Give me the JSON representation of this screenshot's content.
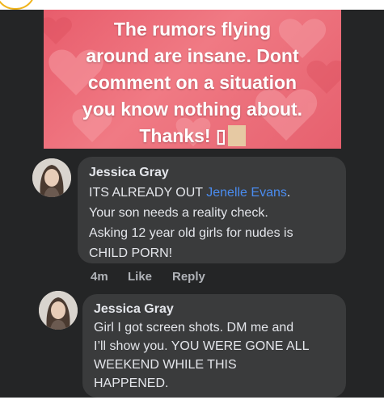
{
  "post": {
    "image_text": {
      "line1": "The rumors flying",
      "line2": "around are insane. Dont",
      "line3": "comment on a situation",
      "line4": "you know nothing about.",
      "line5": "Thanks!",
      "trailing_glyph": "▯"
    },
    "background_color": "#e85d6c"
  },
  "comments": [
    {
      "author": "Jessica Gray",
      "lines": {
        "l1_before": "ITS ALREADY OUT",
        "l1_mention": "Jenelle Evans",
        "l1_after": ".",
        "l2": "Your son needs a reality check.",
        "l3": "Asking 12 year old girls for nudes is",
        "l4": "CHILD PORN!"
      },
      "time": "4m",
      "like_label": "Like",
      "reply_label": "Reply"
    },
    {
      "author": "Jessica Gray",
      "lines": {
        "l1": "Girl I got screen shots. DM me and",
        "l2": "I’ll show you. YOU WERE GONE ALL",
        "l3": "WEEKEND WHILE THIS",
        "l4": "HAPPENED."
      }
    }
  ],
  "colors": {
    "feed_background": "#242526",
    "bubble": "#3a3b3c",
    "text": "#e4e6eb",
    "secondary_text": "#b0b3b8",
    "mention": "#4a8cf0"
  }
}
